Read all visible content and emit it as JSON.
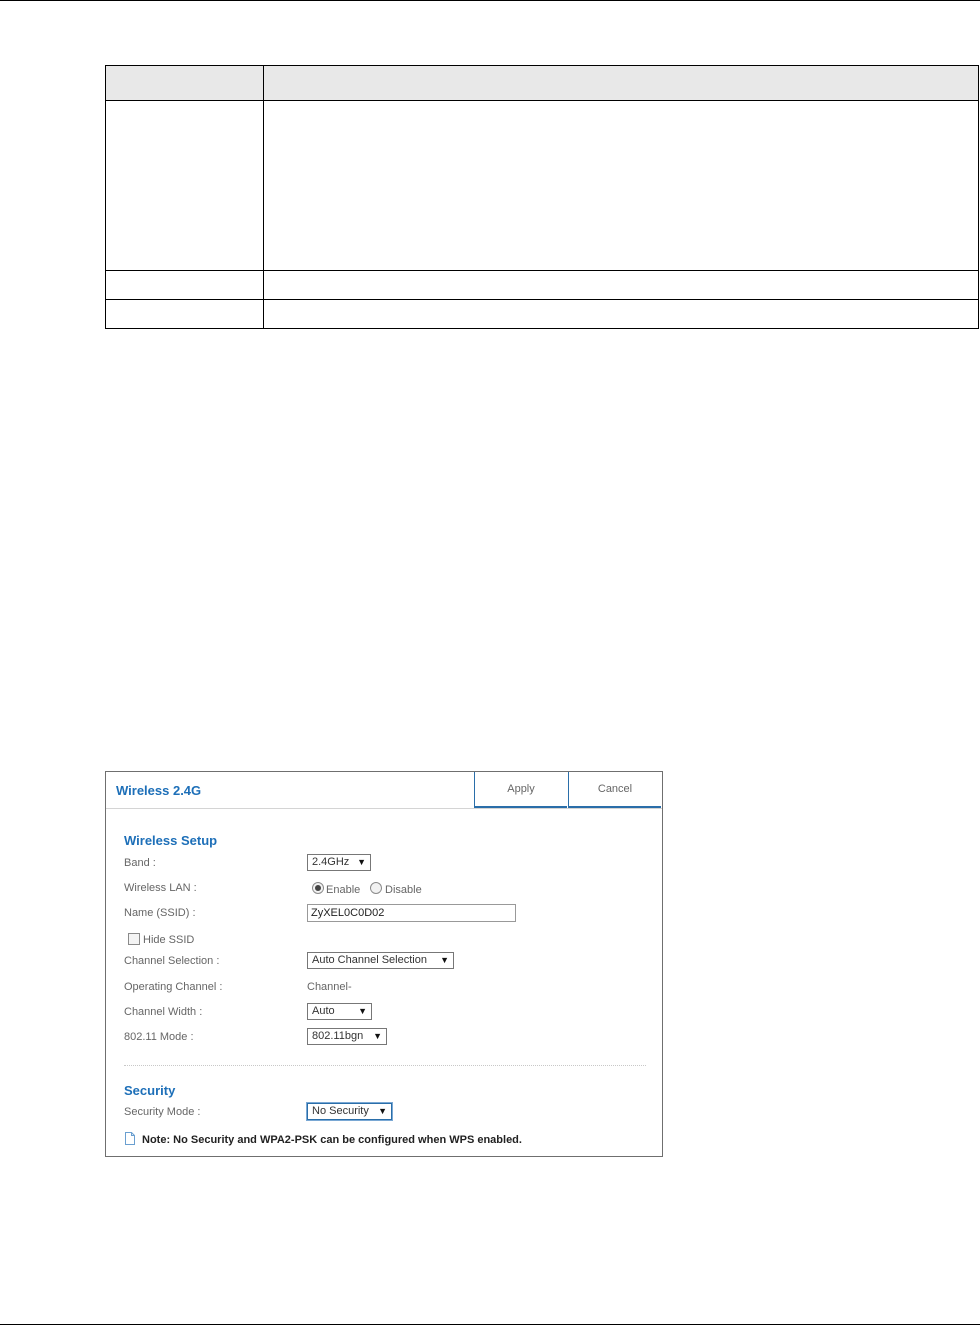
{
  "wireless": {
    "title": "Wireless 2.4G",
    "apply_label": "Apply",
    "cancel_label": "Cancel",
    "setup_title": "Wireless Setup",
    "band_label": "Band :",
    "band_value": "2.4GHz",
    "wlan_label": "Wireless LAN :",
    "enable_label": "Enable",
    "disable_label": "Disable",
    "ssid_label": "Name (SSID) :",
    "ssid_value": "ZyXEL0C0D02",
    "hide_ssid_label": "Hide SSID",
    "channel_selection_label": "Channel Selection :",
    "channel_selection_value": "Auto Channel Selection",
    "operating_channel_label": "Operating Channel :",
    "operating_channel_value": "Channel-",
    "channel_width_label": "Channel Width :",
    "channel_width_value": "Auto",
    "mode_label": "802.11 Mode :",
    "mode_value": "802.11bgn",
    "security_title": "Security",
    "security_mode_label": "Security Mode :",
    "security_mode_value": "No Security",
    "note": "Note: No Security and WPA2-PSK can be configured when WPS enabled."
  },
  "icons": {
    "dropdown": "triangle-down-icon",
    "note": "document-note-icon"
  },
  "colors": {
    "accent": "#1d6fb8",
    "button_border": "#2a6ea9",
    "table_header_bg": "#e8e8e8"
  }
}
